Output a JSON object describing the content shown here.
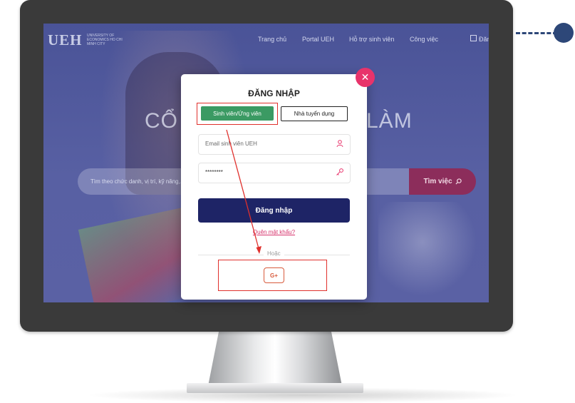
{
  "site": {
    "logo": "UEH",
    "logo_sub": "UNIVERSITY OF ECONOMICS HO CHI MINH CITY",
    "nav": [
      "Trang chủ",
      "Portal UEH",
      "Hỗ trợ sinh viên",
      "Công việc",
      "Đăn"
    ],
    "hero_title_left": "CỔ",
    "hero_title_right": "LÀM",
    "search_placeholder": "Tìm theo chức danh, vị trí, kỹ năng,...",
    "search_button": "Tìm việc"
  },
  "modal": {
    "title": "ĐĂNG NHẬP",
    "tabs": {
      "student": "Sinh viên/Ứng viên",
      "employer": "Nhà tuyển dụng"
    },
    "email_placeholder": "Email sinh viên UEH",
    "password_value": "********",
    "login_button": "Đăng nhập",
    "forgot_link": "Quên mật khẩu?",
    "or_text": "Hoặc",
    "google_label": "G+"
  },
  "colors": {
    "accent_green": "#3b9a63",
    "primary_navy": "#1e2466",
    "close_pink": "#e8336b",
    "highlight_red": "#e0302c",
    "google_red": "#d85a3c"
  }
}
